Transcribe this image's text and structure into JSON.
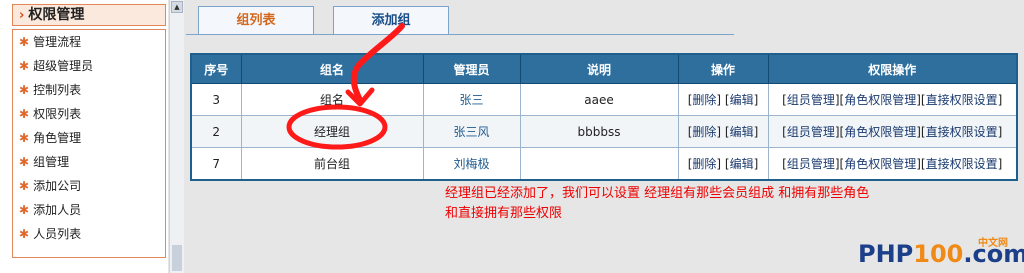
{
  "sidebar": {
    "title": "权限管理",
    "items": [
      {
        "label": "管理流程"
      },
      {
        "label": "超级管理员"
      },
      {
        "label": "控制列表"
      },
      {
        "label": "权限列表"
      },
      {
        "label": "角色管理"
      },
      {
        "label": "组管理"
      },
      {
        "label": "添加公司"
      },
      {
        "label": "添加人员"
      },
      {
        "label": "人员列表"
      }
    ]
  },
  "tabs": {
    "list_label": "组列表",
    "add_label": "添加组"
  },
  "table": {
    "headers": [
      "序号",
      "组名",
      "管理员",
      "说明",
      "操作",
      "权限操作"
    ],
    "rows": [
      {
        "id": "3",
        "name": "组名",
        "admin": "张三",
        "desc": "aaee"
      },
      {
        "id": "2",
        "name": "经理组",
        "admin": "张三风",
        "desc": "bbbbss"
      },
      {
        "id": "7",
        "name": "前台组",
        "admin": "刘梅极",
        "desc": ""
      }
    ],
    "ops": {
      "delete": "删除",
      "edit": "编辑"
    },
    "perm_ops": {
      "group_manage": "组员管理",
      "role_perm": "角色权限管理",
      "direct_perm": "直接权限设置"
    }
  },
  "annotation": {
    "line1": "经理组已经添加了，我们可以设置  经理组有那些会员组成  和拥有那些角色",
    "line2": "和直接拥有那些权限"
  },
  "logo": {
    "brand_a": "PHP",
    "brand_b": "100",
    "brand_c": ".com",
    "cn": "中文网"
  },
  "colors": {
    "header_bg": "#2e6f9e",
    "annotation": "#e00000",
    "accent_orange": "#d4691e"
  }
}
